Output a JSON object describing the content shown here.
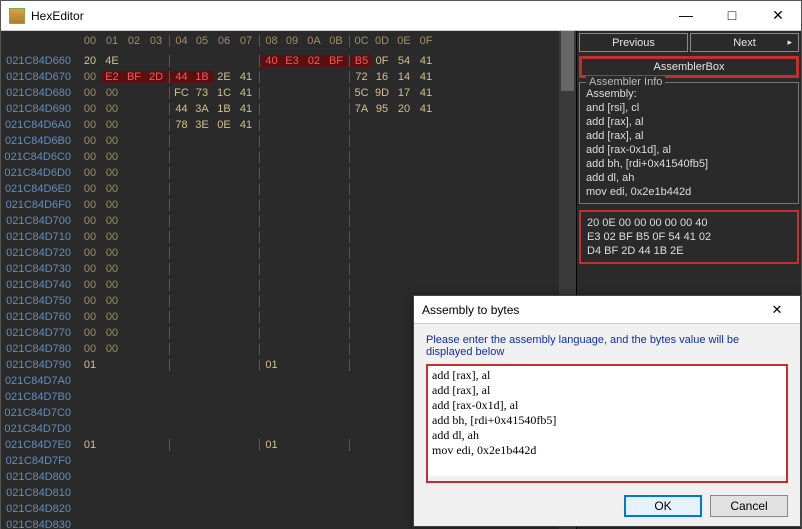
{
  "window": {
    "title": "HexEditor",
    "min_glyph": "—",
    "max_glyph": "□",
    "close_glyph": "✕"
  },
  "hex": {
    "col_offsets": [
      "00",
      "01",
      "02",
      "03",
      "04",
      "05",
      "06",
      "07",
      "08",
      "09",
      "0A",
      "0B",
      "0C",
      "0D",
      "0E",
      "0F"
    ],
    "rows": [
      {
        "addr": "021C84D660",
        "b": [
          "20",
          "4E",
          "",
          "",
          "",
          "",
          "",
          "",
          "40",
          "E3",
          "02",
          "BF",
          "B5",
          "0F",
          "54",
          "41"
        ]
      },
      {
        "addr": "021C84D670",
        "b": [
          "00",
          "E2",
          "BF",
          "2D",
          "44",
          "1B",
          "2E",
          "41",
          "",
          "",
          "",
          "",
          "72",
          "16",
          "14",
          "41"
        ]
      },
      {
        "addr": "021C84D680",
        "b": [
          "00",
          "00",
          "",
          "",
          "FC",
          "73",
          "1C",
          "41",
          "",
          "",
          "",
          "",
          "5C",
          "9D",
          "17",
          "41"
        ]
      },
      {
        "addr": "021C84D690",
        "b": [
          "00",
          "00",
          "",
          "",
          "44",
          "3A",
          "1B",
          "41",
          "",
          "",
          "",
          "",
          "7A",
          "95",
          "20",
          "41"
        ]
      },
      {
        "addr": "021C84D6A0",
        "b": [
          "00",
          "00",
          "",
          "",
          "78",
          "3E",
          "0E",
          "41",
          "",
          "",
          "",
          "",
          "",
          "",
          "",
          ""
        ]
      },
      {
        "addr": "021C84D6B0",
        "b": [
          "00",
          "00",
          "",
          "",
          "",
          "",
          "",
          "",
          "",
          "",
          "",
          "",
          "",
          "",
          "",
          ""
        ]
      },
      {
        "addr": "021C84D6C0",
        "b": [
          "00",
          "00",
          "",
          "",
          "",
          "",
          "",
          "",
          "",
          "",
          "",
          "",
          "",
          "",
          "",
          ""
        ]
      },
      {
        "addr": "021C84D6D0",
        "b": [
          "00",
          "00",
          "",
          "",
          "",
          "",
          "",
          "",
          "",
          "",
          "",
          "",
          "",
          "",
          "",
          ""
        ]
      },
      {
        "addr": "021C84D6E0",
        "b": [
          "00",
          "00",
          "",
          "",
          "",
          "",
          "",
          "",
          "",
          "",
          "",
          "",
          "",
          "",
          "",
          ""
        ]
      },
      {
        "addr": "021C84D6F0",
        "b": [
          "00",
          "00",
          "",
          "",
          "",
          "",
          "",
          "",
          "",
          "",
          "",
          "",
          "",
          "",
          "",
          ""
        ]
      },
      {
        "addr": "021C84D700",
        "b": [
          "00",
          "00",
          "",
          "",
          "",
          "",
          "",
          "",
          "",
          "",
          "",
          "",
          "",
          "",
          "",
          ""
        ]
      },
      {
        "addr": "021C84D710",
        "b": [
          "00",
          "00",
          "",
          "",
          "",
          "",
          "",
          "",
          "",
          "",
          "",
          "",
          "",
          "",
          "",
          ""
        ]
      },
      {
        "addr": "021C84D720",
        "b": [
          "00",
          "00",
          "",
          "",
          "",
          "",
          "",
          "",
          "",
          "",
          "",
          "",
          "",
          "",
          "",
          ""
        ]
      },
      {
        "addr": "021C84D730",
        "b": [
          "00",
          "00",
          "",
          "",
          "",
          "",
          "",
          "",
          "",
          "",
          "",
          "",
          "",
          "",
          "",
          ""
        ]
      },
      {
        "addr": "021C84D740",
        "b": [
          "00",
          "00",
          "",
          "",
          "",
          "",
          "",
          "",
          "",
          "",
          "",
          "",
          "",
          "",
          "",
          ""
        ]
      },
      {
        "addr": "021C84D750",
        "b": [
          "00",
          "00",
          "",
          "",
          "",
          "",
          "",
          "",
          "",
          "",
          "",
          "",
          "",
          "",
          "",
          ""
        ]
      },
      {
        "addr": "021C84D760",
        "b": [
          "00",
          "00",
          "",
          "",
          "",
          "",
          "",
          "",
          "",
          "",
          "",
          "",
          "",
          "",
          "",
          ""
        ]
      },
      {
        "addr": "021C84D770",
        "b": [
          "00",
          "00",
          "",
          "",
          "",
          "",
          "",
          "",
          "",
          "",
          "",
          "",
          "",
          "",
          "",
          ""
        ]
      },
      {
        "addr": "021C84D780",
        "b": [
          "00",
          "00",
          "",
          "",
          "",
          "",
          "",
          "",
          "",
          "",
          "",
          "",
          "",
          "",
          "",
          ""
        ]
      },
      {
        "addr": "021C84D790",
        "b": [
          "01",
          "",
          "",
          "",
          "",
          "",
          "",
          "",
          "01",
          "",
          "",
          "",
          "",
          "",
          "",
          ""
        ]
      },
      {
        "addr": "021C84D7A0",
        "b": [
          "",
          "",
          "",
          "",
          "",
          "",
          "",
          "",
          "",
          "",
          "",
          "",
          "",
          "",
          "",
          ""
        ]
      },
      {
        "addr": "021C84D7B0",
        "b": [
          "",
          "",
          "",
          "",
          "",
          "",
          "",
          "",
          "",
          "",
          "",
          "",
          "",
          "",
          "",
          ""
        ]
      },
      {
        "addr": "021C84D7C0",
        "b": [
          "",
          "",
          "",
          "",
          "",
          "",
          "",
          "",
          "",
          "",
          "",
          "",
          "",
          "",
          "",
          ""
        ]
      },
      {
        "addr": "021C84D7D0",
        "b": [
          "",
          "",
          "",
          "",
          "",
          "",
          "",
          "",
          "",
          "",
          "",
          "",
          "",
          "",
          "",
          ""
        ]
      },
      {
        "addr": "021C84D7E0",
        "b": [
          "01",
          "",
          "",
          "",
          "",
          "",
          "",
          "",
          "01",
          "",
          "",
          "",
          "",
          "",
          "",
          ""
        ]
      },
      {
        "addr": "021C84D7F0",
        "b": [
          "",
          "",
          "",
          "",
          "",
          "",
          "",
          "",
          "",
          "",
          "",
          "",
          "",
          "",
          "",
          ""
        ]
      },
      {
        "addr": "021C84D800",
        "b": [
          "",
          "",
          "",
          "",
          "",
          "",
          "",
          "",
          "",
          "",
          "",
          "",
          "",
          "",
          "",
          ""
        ]
      },
      {
        "addr": "021C84D810",
        "b": [
          "",
          "",
          "",
          "",
          "",
          "",
          "",
          "",
          "",
          "",
          "",
          "",
          "",
          "",
          "",
          ""
        ]
      },
      {
        "addr": "021C84D820",
        "b": [
          "",
          "",
          "",
          "",
          "",
          "",
          "",
          "",
          "",
          "",
          "",
          "",
          "",
          "",
          "",
          ""
        ]
      },
      {
        "addr": "021C84D830",
        "b": [
          "",
          "",
          "",
          "",
          "",
          "",
          "",
          "",
          "",
          "",
          "",
          "",
          "",
          "",
          "",
          ""
        ]
      }
    ],
    "highlight_red": [
      "0:8",
      "0:9",
      "0:10",
      "0:11",
      "0:12",
      "1:1",
      "1:2",
      "1:3",
      "1:4",
      "1:5"
    ]
  },
  "nav": {
    "prev": "Previous",
    "next": "Next"
  },
  "assembler_button": "AssemblerBox",
  "assembler_info": {
    "legend": "Assembler Info",
    "text": "Assembly:\nand [rsi], cl\nadd [rax], al\nadd [rax], al\nadd [rax-0x1d], al\nadd bh, [rdi+0x41540fb5]\nadd dl, ah\nmov edi, 0x2e1b442d"
  },
  "hex_output": "20 0E 00 00 00 00 00 40\nE3 02 BF B5 0F 54 41 02\nD4 BF 2D 44 1B 2E",
  "modal": {
    "title": "Assembly to bytes",
    "close_glyph": "✕",
    "prompt": "Please enter the assembly language, and the bytes value will be displayed below",
    "input": "add [rax], al\nadd [rax], al\nadd [rax-0x1d], al\nadd bh, [rdi+0x41540fb5]\nadd dl, ah\nmov edi, 0x2e1b442d",
    "ok": "OK",
    "cancel": "Cancel"
  }
}
